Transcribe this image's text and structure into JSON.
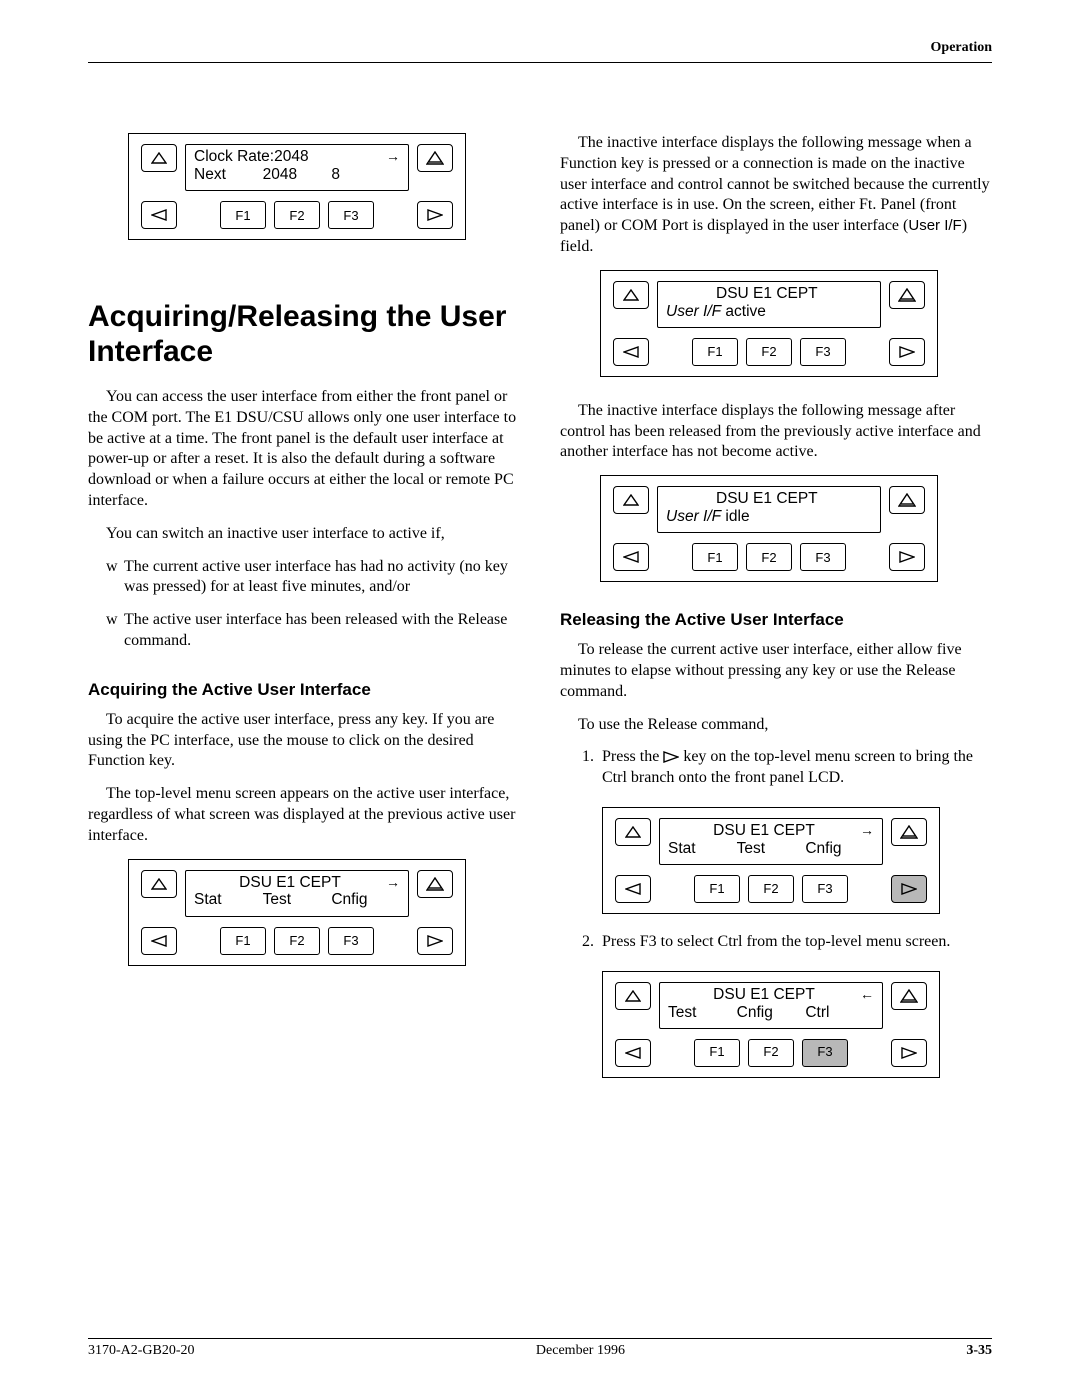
{
  "header": {
    "section": "Operation"
  },
  "panel_clock": {
    "line1": "Clock Rate:2048",
    "arrow": "→",
    "line2_a": "Next",
    "line2_b": "2048",
    "line2_c": "8",
    "f1": "F1",
    "f2": "F2",
    "f3": "F3"
  },
  "left": {
    "title": "Acquiring/Releasing the User Interface",
    "p1": "You can access the user interface from either the front panel or the COM port. The E1 DSU/CSU allows only one user interface to be active at a time. The front panel is the default user interface at power-up or after a reset. It is also the default during a software download or when a failure occurs at either the local or remote PC interface.",
    "p2": "You can switch an inactive user interface to active if,",
    "b1": "The current active user interface has had no activity (no key was pressed) for at least five minutes, and/or",
    "b2": "The active user interface has been released with the Release command.",
    "sub1": "Acquiring the Active User Interface",
    "p3": "To acquire the active user interface, press any key. If you are using the PC interface, use the mouse to click on the desired Function key.",
    "p4": "The top-level menu screen appears on the active user interface, regardless of what screen was displayed at the previous active user interface."
  },
  "panel_menu1": {
    "line1": "DSU E1 CEPT",
    "arrow": "→",
    "c1": "Stat",
    "c2": "Test",
    "c3": "Cnfig",
    "f1": "F1",
    "f2": "F2",
    "f3": "F3"
  },
  "right": {
    "p1": "The inactive interface displays the following message when a Function key is pressed or a connection is made on the inactive user interface and control cannot be switched because the currently active interface is in use. On the screen, either Ft. Panel (front panel) or COM Port is displayed in the user interface (",
    "p1_inline": "User I/F",
    "p1_after": ") field.",
    "p2": "The inactive interface displays the following message after control has been released from the previously active interface and another interface has not become active.",
    "sub2": "Releasing the Active User Interface",
    "p3": "To release the current active user interface, either allow five minutes to elapse without pressing any key or use the Release command.",
    "p4": "To use the Release command,",
    "s1a": "Press the ",
    "s1b": " key on the top-level menu screen to bring the Ctrl branch onto the front panel LCD.",
    "s2": "Press F3 to select Ctrl from the top-level menu screen."
  },
  "panel_active": {
    "line1": "DSU E1 CEPT",
    "it": "User I/F",
    "status": " active",
    "f1": "F1",
    "f2": "F2",
    "f3": "F3"
  },
  "panel_idle": {
    "line1": "DSU E1 CEPT",
    "it": "User I/F",
    "status": " idle",
    "f1": "F1",
    "f2": "F2",
    "f3": "F3"
  },
  "panel_menu2": {
    "line1": "DSU E1 CEPT",
    "arrow": "→",
    "c1": "Stat",
    "c2": "Test",
    "c3": "Cnfig",
    "f1": "F1",
    "f2": "F2",
    "f3": "F3"
  },
  "panel_menu3": {
    "line1": "DSU E1 CEPT",
    "arrow": "←",
    "c1": "Test",
    "c2": "Cnfig",
    "c3": "Ctrl",
    "f1": "F1",
    "f2": "F2",
    "f3": "F3"
  },
  "footer": {
    "left": "3170-A2-GB20-20",
    "center": "December 1996",
    "right": "3-35"
  }
}
